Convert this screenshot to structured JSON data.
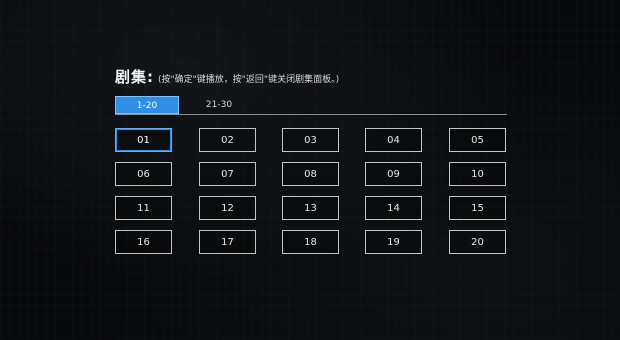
{
  "header": {
    "title": "剧集:",
    "hint": "(按\"确定\"键播放，按\"返回\"键关闭剧集面板。)"
  },
  "tabs": [
    {
      "label": "1-20",
      "active": true
    },
    {
      "label": "21-30",
      "active": false
    }
  ],
  "episodes": [
    "01",
    "02",
    "03",
    "04",
    "05",
    "06",
    "07",
    "08",
    "09",
    "10",
    "11",
    "12",
    "13",
    "14",
    "15",
    "16",
    "17",
    "18",
    "19",
    "20"
  ],
  "focused_episode": "01",
  "colors": {
    "accent": "#2f8fe6",
    "border": "#bfc4c7",
    "background": "#0b0d10"
  }
}
